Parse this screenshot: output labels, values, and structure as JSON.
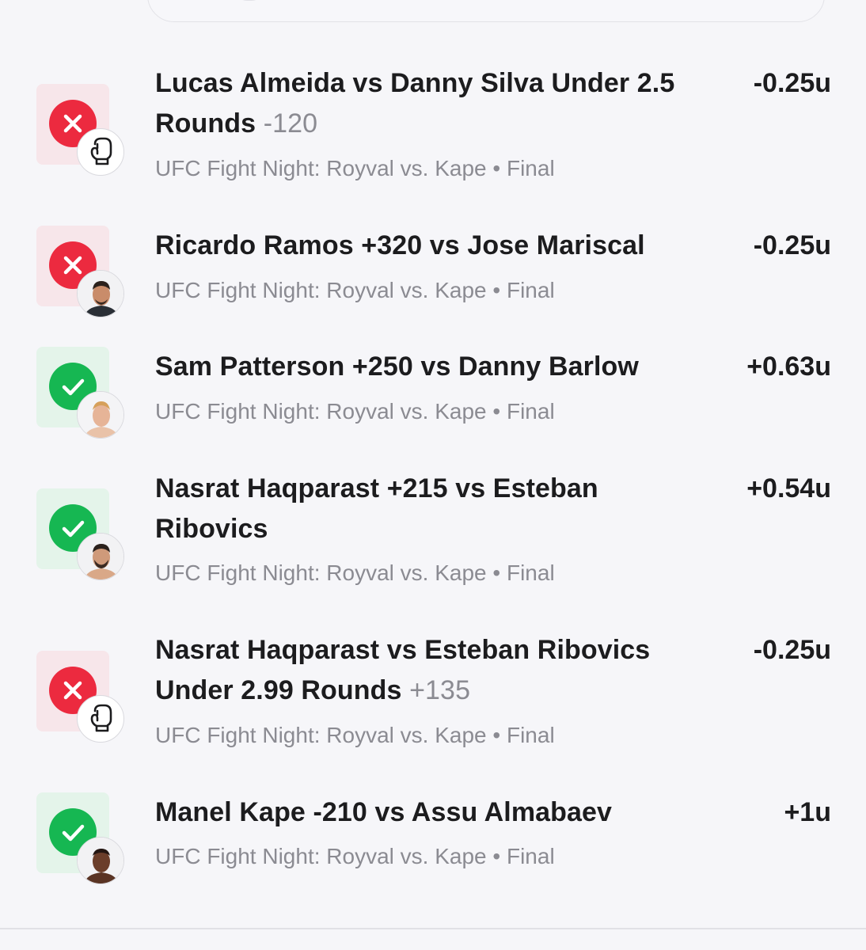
{
  "colors": {
    "loss": "#ec2a3f",
    "win": "#16b752",
    "loss_bg": "#f7e6ea",
    "win_bg": "#e4f4ea",
    "text": "#1c1c1e",
    "muted": "#8b8b92"
  },
  "bets": [
    {
      "result": "loss",
      "result_icon": "x-icon",
      "thumb": "boxing-glove-icon",
      "title": "Lucas Almeida vs Danny Silva Under 2.5 Rounds",
      "odds": "-120",
      "event": "UFC Fight Night: Royval vs. Kape",
      "separator": "•",
      "status": "Final",
      "units": "-0.25u"
    },
    {
      "result": "loss",
      "result_icon": "x-icon",
      "thumb": "fighter-avatar",
      "title": "Ricardo Ramos +320 vs Jose Mariscal",
      "odds": "",
      "event": "UFC Fight Night: Royval vs. Kape",
      "separator": "•",
      "status": "Final",
      "units": "-0.25u"
    },
    {
      "result": "win",
      "result_icon": "check-icon",
      "thumb": "fighter-avatar",
      "title": "Sam Patterson +250 vs Danny Barlow",
      "odds": "",
      "event": "UFC Fight Night: Royval vs. Kape",
      "separator": "•",
      "status": "Final",
      "units": "+0.63u"
    },
    {
      "result": "win",
      "result_icon": "check-icon",
      "thumb": "fighter-avatar",
      "title": "Nasrat Haqparast +215 vs Esteban Ribovics",
      "odds": "",
      "event": "UFC Fight Night: Royval vs. Kape",
      "separator": "•",
      "status": "Final",
      "units": "+0.54u"
    },
    {
      "result": "loss",
      "result_icon": "x-icon",
      "thumb": "boxing-glove-icon",
      "title": "Nasrat Haqparast vs Esteban Ribovics Under 2.99 Rounds",
      "odds": "+135",
      "event": "UFC Fight Night: Royval vs. Kape",
      "separator": "•",
      "status": "Final",
      "units": "-0.25u"
    },
    {
      "result": "win",
      "result_icon": "check-icon",
      "thumb": "fighter-avatar",
      "title": "Manel Kape -210 vs Assu Almabaev",
      "odds": "",
      "event": "UFC Fight Night: Royval vs. Kape",
      "separator": "•",
      "status": "Final",
      "units": "+1u"
    }
  ]
}
